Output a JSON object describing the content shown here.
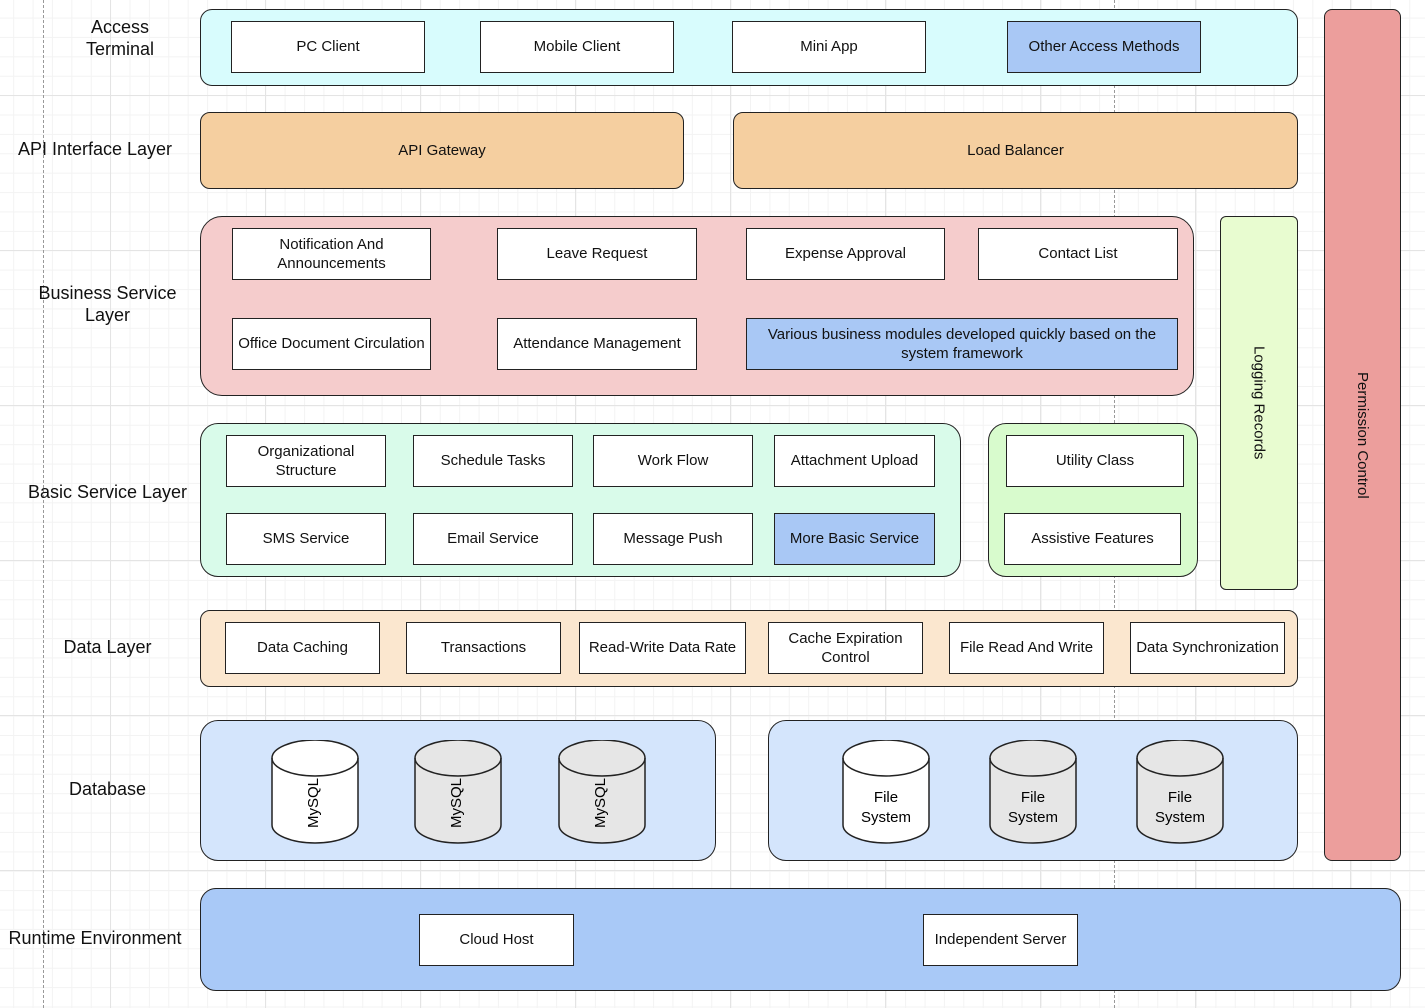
{
  "layers": {
    "access": "Access Terminal",
    "api": "API Interface Layer",
    "business": "Business Service Layer",
    "basic": "Basic Service Layer",
    "data": "Data Layer",
    "database": "Database",
    "runtime": "Runtime Environment"
  },
  "access": [
    "PC Client",
    "Mobile Client",
    "Mini App",
    "Other Access Methods"
  ],
  "api": [
    "API Gateway",
    "Load Balancer"
  ],
  "business": [
    "Notification And Announcements",
    "Leave Request",
    "Expense Approval",
    "Contact List",
    "Office Document Circulation",
    "Attendance Management",
    "Various business modules developed quickly based on the system framework"
  ],
  "basic": [
    "Organizational Structure",
    "Schedule Tasks",
    "Work Flow",
    "Attachment Upload",
    "SMS Service",
    "Email Service",
    "Message Push",
    "More Basic Service"
  ],
  "utility": [
    "Utility Class",
    "Assistive Features"
  ],
  "data": [
    "Data Caching",
    "Transactions",
    "Read-Write Data Rate",
    "Cache Expiration Control",
    "File Read And Write",
    "Data Synchronization"
  ],
  "database": {
    "mysql": [
      "MySQL",
      "MySQL",
      "MySQL"
    ],
    "files": [
      "File System",
      "File System",
      "File System"
    ]
  },
  "runtime": [
    "Cloud Host",
    "Independent Server"
  ],
  "side": {
    "logging": "Logging Records",
    "permission": "Permission Control"
  },
  "colors": {
    "access": "#d8fcfd",
    "api": "#f5cfa0",
    "business": "#f5cccc",
    "basic": "#d9fbea",
    "utility": "#d8fbcd",
    "logging": "#e8fcd0",
    "permission": "#ec9e9c",
    "data": "#fbe7cf",
    "database": "#d4e5fc",
    "runtime": "#a9c9f7",
    "highlight": "#a9c8f5"
  }
}
